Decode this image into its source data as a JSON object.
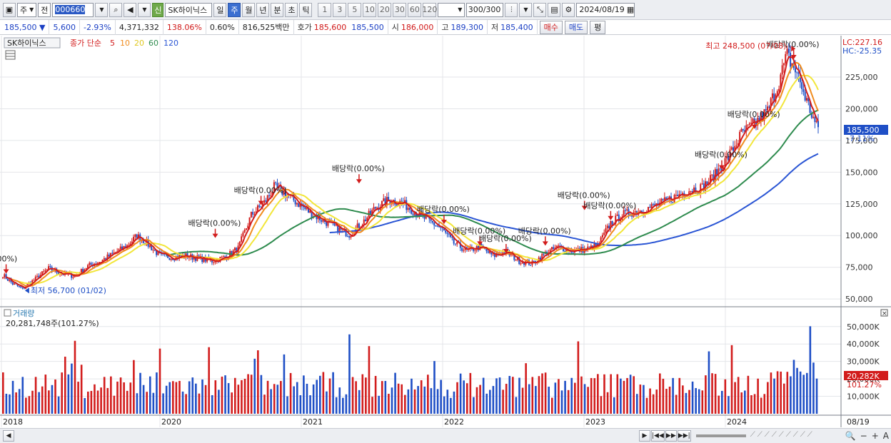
{
  "toolbar": {
    "period_type": "주",
    "market_type": "전",
    "code": "000660",
    "new_label": "신",
    "stock_name": "SK하이닉스",
    "periods": [
      "일",
      "주",
      "월",
      "년",
      "분",
      "초",
      "틱"
    ],
    "selected_period": "주",
    "intervals": [
      "1",
      "3",
      "5",
      "10",
      "20",
      "30",
      "60",
      "120"
    ],
    "count": "300",
    "count_total": "/300",
    "date": "2024/08/19"
  },
  "quote": {
    "price": "185,500",
    "arrow": "▼",
    "change": "5,600",
    "change_pct": "-2.93%",
    "volume": "4,371,332",
    "volume_ratio": "138.06%",
    "turnover": "0.60%",
    "amount": "816,525백만",
    "ask_label": "호가",
    "ask1": "185,600",
    "ask2": "185,500",
    "open_label": "시",
    "open": "186,000",
    "high_label": "고",
    "high": "189,300",
    "low_label": "저",
    "low": "185,400",
    "buy_label": "매수",
    "sell_label": "매도",
    "eval_label": "평"
  },
  "legend": {
    "name": "SK하이닉스",
    "close_label": "종가 단순",
    "ma": [
      "5",
      "10",
      "20",
      "60",
      "120"
    ]
  },
  "colors": {
    "up": "#d21c1c",
    "down": "#1f4fc6",
    "ma5": "#d21c1c",
    "ma10": "#f08c1e",
    "ma20": "#f2e63a",
    "ma60": "#2e8b4e",
    "ma120": "#2a55d4"
  },
  "chart_data": {
    "type": "candlestick",
    "price_axis": [
      "225,000",
      "200,000",
      "175,000",
      "150,000",
      "125,000",
      "100,000",
      "75,000",
      "50,000"
    ],
    "price_range": [
      45000,
      252000
    ],
    "current_price_label": "185,500",
    "current_change_label": "-7.11%",
    "lc_label": "LC:227.16",
    "hc_label": "HC:-25.35",
    "x_labels": [
      "2018",
      "2020",
      "2021",
      "2022",
      "2023",
      "2024",
      "08/19"
    ],
    "annotations": {
      "high": "최고 248,500 (07/08)",
      "low": "최저 56,700 (01/02)",
      "dividend_labels": [
        "락(0.00%)",
        "배당락(0.00%)",
        "배당락(0.00%)",
        "배당락(0.00%)",
        "배당락(0.00%)",
        "배당락(0.00%)",
        "배당락(0.00%)",
        "배당락(0.00%)",
        "배당락(0.00%)",
        "배당락(0.00%)",
        "배당락(0.00%)",
        "배당락(0.00%)",
        "배당락(0.00%)"
      ]
    },
    "trend_points": [
      [
        0,
        69000
      ],
      [
        6,
        62000
      ],
      [
        12,
        58000
      ],
      [
        20,
        66000
      ],
      [
        28,
        74000
      ],
      [
        36,
        70000
      ],
      [
        44,
        68000
      ],
      [
        52,
        76000
      ],
      [
        60,
        80000
      ],
      [
        68,
        86000
      ],
      [
        76,
        92000
      ],
      [
        82,
        100000
      ],
      [
        88,
        94000
      ],
      [
        96,
        84000
      ],
      [
        104,
        83000
      ],
      [
        112,
        84000
      ],
      [
        120,
        82000
      ],
      [
        128,
        80000
      ],
      [
        136,
        83000
      ],
      [
        144,
        90000
      ],
      [
        152,
        116000
      ],
      [
        160,
        126000
      ],
      [
        166,
        138000
      ],
      [
        172,
        134000
      ],
      [
        180,
        126000
      ],
      [
        188,
        118000
      ],
      [
        196,
        112000
      ],
      [
        204,
        106000
      ],
      [
        212,
        101000
      ],
      [
        220,
        110000
      ],
      [
        228,
        122000
      ],
      [
        236,
        128000
      ],
      [
        244,
        126000
      ],
      [
        252,
        119000
      ],
      [
        260,
        112000
      ],
      [
        268,
        106000
      ],
      [
        276,
        94000
      ],
      [
        284,
        88000
      ],
      [
        292,
        91000
      ],
      [
        300,
        84000
      ],
      [
        308,
        87000
      ],
      [
        316,
        80000
      ],
      [
        324,
        78000
      ],
      [
        332,
        86000
      ],
      [
        340,
        91000
      ],
      [
        348,
        88000
      ],
      [
        356,
        89000
      ],
      [
        364,
        92000
      ],
      [
        372,
        110000
      ],
      [
        380,
        117000
      ],
      [
        388,
        119000
      ],
      [
        396,
        122000
      ],
      [
        404,
        126000
      ],
      [
        412,
        131000
      ],
      [
        420,
        136000
      ],
      [
        428,
        138000
      ],
      [
        436,
        148000
      ],
      [
        444,
        162000
      ],
      [
        452,
        180000
      ],
      [
        460,
        188000
      ],
      [
        468,
        198000
      ],
      [
        474,
        218000
      ],
      [
        480,
        242000
      ],
      [
        486,
        228000
      ],
      [
        492,
        206000
      ],
      [
        498,
        185500
      ]
    ],
    "volume": {
      "title": "거래량",
      "value": "20,281,748주(101.27%)",
      "axis": [
        "50,000K",
        "40,000K",
        "30,000K",
        "20,000K",
        "10,000K"
      ],
      "current_label": "20,282K",
      "current_pct": "101.27%",
      "range": [
        0,
        54000
      ]
    }
  },
  "bottom": {
    "nav": [
      "▶",
      "|◀◀",
      "▶▶",
      "▶▶|"
    ],
    "tools": [
      "🔍",
      "−",
      "+",
      "A"
    ]
  }
}
